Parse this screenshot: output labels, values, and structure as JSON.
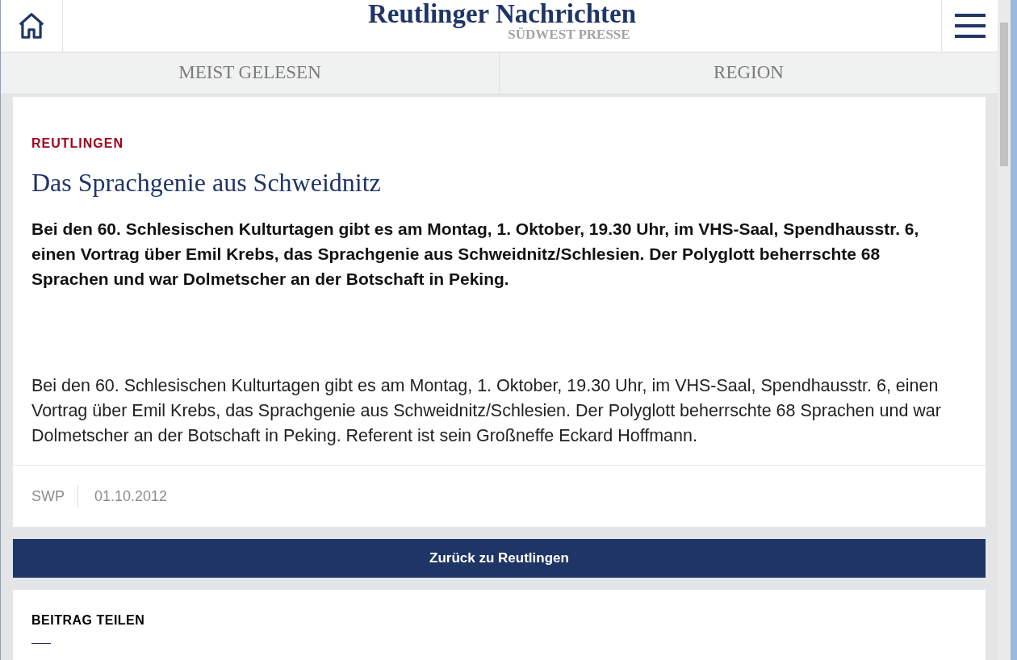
{
  "header": {
    "title": "Reutlinger Nachrichten",
    "subtitle": "SÜDWEST PRESSE"
  },
  "tabs": [
    {
      "label": "MEIST GELESEN",
      "selected": false
    },
    {
      "label": "REGION",
      "selected": false
    }
  ],
  "article": {
    "category": "REUTLINGEN",
    "headline": "Das Sprachgenie aus Schweidnitz",
    "lead": "Bei den 60. Schlesischen Kulturtagen gibt es am Montag, 1. Oktober, 19.30 Uhr, im VHS-Saal, Spendhausstr. 6, einen Vortrag über Emil Krebs, das Sprachgenie aus Schweidnitz/Schlesien. Der Polyglott beherrschte 68 Sprachen und war Dolmetscher an der Botschaft in Peking.",
    "body": "Bei den 60. Schlesischen Kulturtagen gibt es am Montag, 1. Oktober, 19.30 Uhr, im VHS-Saal, Spendhausstr. 6, einen Vortrag über Emil Krebs, das Sprachgenie aus Schweidnitz/Schlesien. Der Polyglott beherrschte 68 Sprachen und war Dolmetscher an der Botschaft in Peking. Referent ist sein Großneffe Eckard Hoffmann.",
    "source": "SWP",
    "date": "01.10.2012"
  },
  "back_button": "Zurück zu Reutlingen",
  "share": {
    "heading": "BEITRAG TEILEN"
  }
}
